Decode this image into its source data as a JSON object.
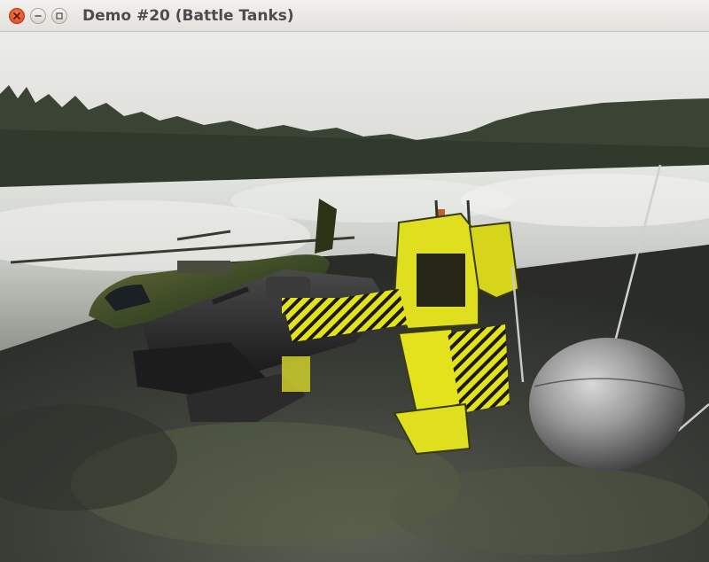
{
  "window": {
    "title": "Demo #20 (Battle Tanks)",
    "controls": [
      "close",
      "minimize",
      "maximize"
    ]
  },
  "scene": {
    "description_icons": [
      "helicopter-model",
      "hover-tank-model",
      "power-loader-mech-model",
      "spherical-drone-model"
    ],
    "colors": {
      "sky": "#e6e6e2",
      "water": "#d8dbd6",
      "rock": "#4a4d46",
      "mech": "#e3e21c",
      "tank": "#2a2a2a",
      "camo": "#4b5a2f",
      "sphere": "#9a9a9a"
    }
  }
}
